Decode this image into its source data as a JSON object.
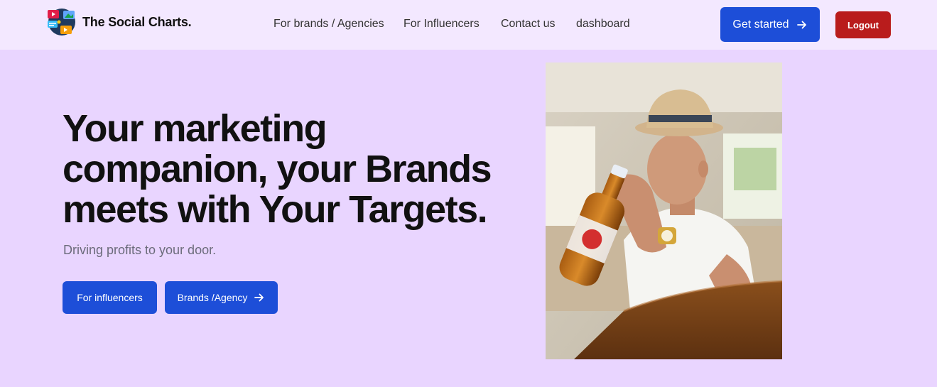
{
  "brand": {
    "name": "The Social Charts."
  },
  "nav": {
    "items": [
      {
        "label": "For brands / Agencies"
      },
      {
        "label": "For Influencers"
      },
      {
        "label": "Contact us"
      },
      {
        "label": "dashboard"
      }
    ]
  },
  "header": {
    "get_started_label": "Get started",
    "logout_label": "Logout"
  },
  "hero": {
    "title_lines": [
      "Your marketing",
      "companion, your Brands",
      "meets with Your Targets."
    ],
    "subtitle": "Driving profits to your door.",
    "cta_influencers_label": "For influencers",
    "cta_brands_label": "Brands /Agency"
  },
  "colors": {
    "page_bg": "#e9d5ff",
    "header_bg": "#f3e8ff",
    "primary_button": "#1d4ed8",
    "logout_button": "#b91c1c"
  },
  "icons": {
    "cta_arrow": "arrow-right-icon"
  }
}
